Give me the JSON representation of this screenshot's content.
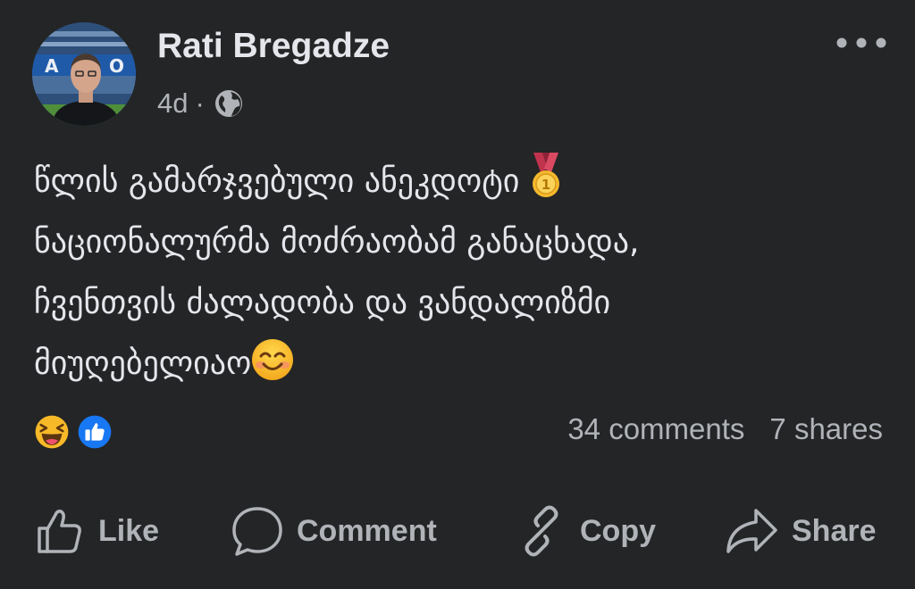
{
  "post": {
    "author": "Rati Bregadze",
    "time": "4d",
    "separator": "·",
    "audience_icon": "globe-icon",
    "more_icon": "more-options-icon",
    "text_lines": [
      "წლის გამარჯვებული ანეკდოტი ",
      "ნაციონალურმა მოძრაობამ განაცხადა,",
      "ჩვენთვის ძალადობა და ვანდალიზმი",
      "მიუღებელიაო"
    ],
    "inline_emojis": [
      "first-place-medal-emoji",
      "smiling-face-emoji"
    ]
  },
  "reactions": {
    "icons": [
      "laughing-reaction-icon",
      "like-reaction-icon"
    ],
    "comments": "34 comments",
    "shares": "7 shares"
  },
  "actions": {
    "like": "Like",
    "comment": "Comment",
    "copy": "Copy",
    "share": "Share"
  },
  "colors": {
    "background": "#242526",
    "primary_text": "#e4e6eb",
    "secondary_text": "#b0b3b8",
    "like_blue": "#1877f2",
    "reaction_yellow": "#f7b928"
  }
}
